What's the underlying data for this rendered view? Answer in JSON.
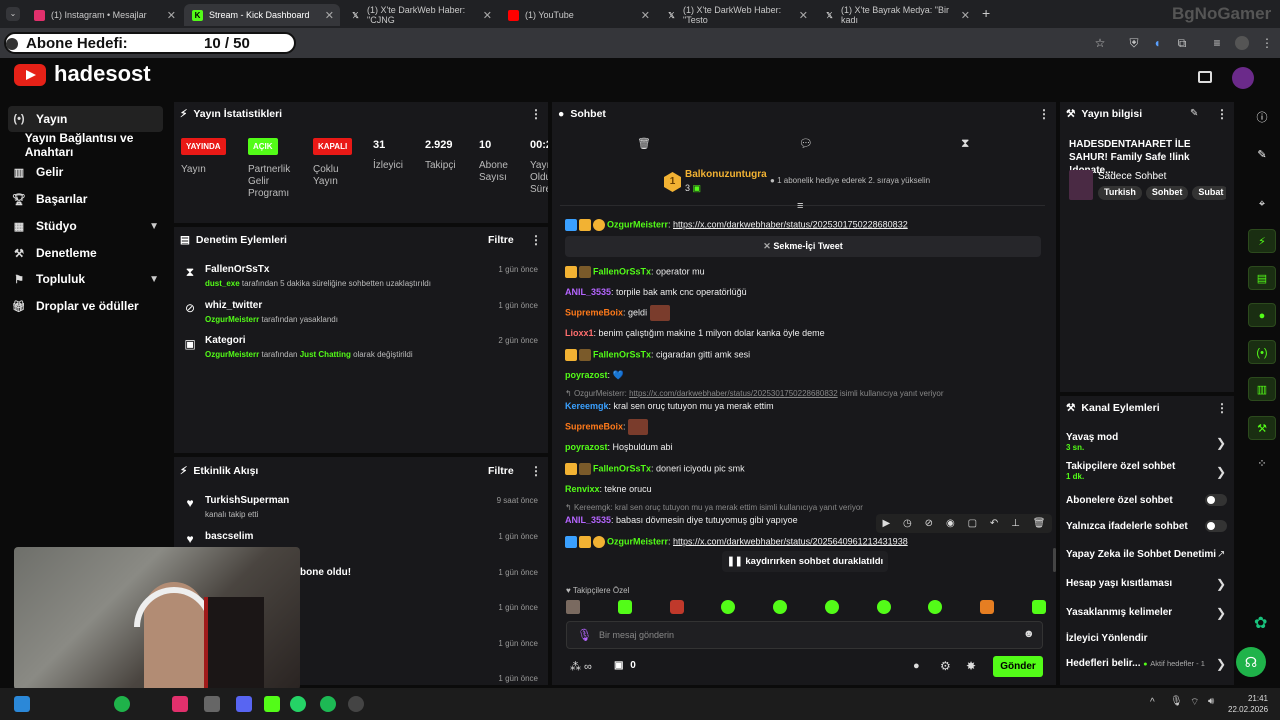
{
  "browser": {
    "tabs": [
      {
        "label": "(1) Instagram • Mesajlar",
        "color": "#e1306c"
      },
      {
        "label": "Stream - Kick Dashboard",
        "color": "#53fc18",
        "active": true
      },
      {
        "label": "(1) X'te DarkWeb Haber: \"CJNG",
        "color": "#000"
      },
      {
        "label": "(1) YouTube",
        "color": "#ff0000"
      },
      {
        "label": "(1) X'te DarkWeb Haber: \"Testo",
        "color": "#000"
      },
      {
        "label": "(1) X'te Bayrak Medya: \"Bir kadı",
        "color": "#000"
      }
    ],
    "watermark": "BgNoGamer"
  },
  "goal": {
    "label": "Abone Hedefi:",
    "value": "10 / 50"
  },
  "brand": "hadesost",
  "sidebar": [
    {
      "label": "Yayın",
      "icon": "broadcast-icon",
      "active": true
    },
    {
      "label": "Yayın Bağlantısı ve Anahtarı",
      "icon": ""
    },
    {
      "label": "Gelir",
      "icon": "revenue-icon"
    },
    {
      "label": "Başarılar",
      "icon": "trophy-icon"
    },
    {
      "label": "Stüdyo",
      "icon": "studio-icon",
      "chevron": true
    },
    {
      "label": "Denetleme",
      "icon": "wrench-icon"
    },
    {
      "label": "Topluluk",
      "icon": "community-icon",
      "chevron": true
    },
    {
      "label": "Droplar ve ödüller",
      "icon": "gift-icon"
    }
  ],
  "stats": {
    "title": "Yayın İstatistikleri",
    "badges": [
      {
        "text": "YAYINDA",
        "label": "Yayın",
        "bg": "#e91916",
        "fg": "#fff"
      },
      {
        "text": "AÇIK",
        "label": "Partnerlik Gelir Programı",
        "bg": "#53fc18",
        "fg": "#fff"
      },
      {
        "text": "KAPALI",
        "label": "Çoklu Yayın",
        "bg": "#e91916",
        "fg": "#fff"
      }
    ],
    "numbers": [
      {
        "value": "31",
        "label": "İzleyici"
      },
      {
        "value": "2.929",
        "label": "Takipçi"
      },
      {
        "value": "10",
        "label": "Abone Sayısı"
      },
      {
        "value": "00:2",
        "label": "Yayı Oldu Süre"
      }
    ]
  },
  "mod": {
    "title": "Denetim Eylemleri",
    "filter": "Filtre",
    "items": [
      {
        "name": "FallenOrSsTx",
        "who": "dust_exe",
        "text": "tarafından 5 dakika süreliğine sohbetten uzaklaştırıldı",
        "time": "1 gün önce"
      },
      {
        "name": "whiz_twitter",
        "who": "OzgurMeisterr",
        "text": "tarafından yasaklandı",
        "time": "1 gün önce"
      },
      {
        "name": "Kategori",
        "who": "OzgurMeisterr",
        "text": "tarafından",
        "extra": "Just Chatting",
        "text2": "olarak değiştirildi",
        "time": "2 gün önce"
      }
    ]
  },
  "activity": {
    "title": "Etkinlik Akışı",
    "filter": "Filtre",
    "items": [
      {
        "name": "TurkishSuperman",
        "sub": "kanalı takip etti",
        "time": "9 saat önce"
      },
      {
        "name": "bascselim",
        "sub": "",
        "time": "1 gün önce"
      },
      {
        "name": "",
        "sub": "",
        "partial": "bone oldu!",
        "time": "1 gün önce"
      },
      {
        "name": "",
        "sub": "",
        "time": "1 gün önce"
      },
      {
        "name": "",
        "sub": "",
        "time": "1 gün önce"
      },
      {
        "name": "",
        "sub": "",
        "time": "1 gün önce"
      }
    ]
  },
  "chat": {
    "title": "Sohbet",
    "pinned": {
      "user": "Balkonuzuntugra",
      "count": "3",
      "rank": "1",
      "text": "1 abonelik hediye ederek 2. sıraya yükselin"
    },
    "tweet_link": "https://x.com/darkwebhaber/status/2025301750228680832",
    "tweet_btn": "Sekme-İçi Tweet",
    "messages": [
      {
        "user": "OzgurMeisterr",
        "color": "#53fc18",
        "link": "https://x.com/darkwebhaber/status/2025301750228680832"
      },
      {
        "user": "FallenOrSsTx",
        "color": "#53fc18",
        "text": "operator mu"
      },
      {
        "user": "ANIL_3535",
        "color": "#b565ff",
        "text": "torpile bak amk cnc operatörlüğü"
      },
      {
        "user": "SupremeBoix",
        "color": "#ff7a1a",
        "text": "geldi"
      },
      {
        "user": "Lioxx1",
        "color": "#ff6e6e",
        "text": "benim çalıştığım makine 1 milyon dolar kanka öyle deme"
      },
      {
        "user": "FallenOrSsTx",
        "color": "#53fc18",
        "text": "cigaradan gitti amk sesi"
      },
      {
        "user": "poyrazost",
        "color": "#53fc18",
        "text": "💙"
      },
      {
        "user": "Kereemgk",
        "color": "#3aa0ff",
        "text": "kral sen oruç tutuyon mu ya merak ettim"
      },
      {
        "user": "SupremeBoix",
        "color": "#ff7a1a",
        "text": ""
      },
      {
        "user": "poyrazost",
        "color": "#53fc18",
        "text": "Hoşbuldum abi"
      },
      {
        "user": "FallenOrSsTx",
        "color": "#53fc18",
        "text": "doneri iciyodu pic smk"
      },
      {
        "user": "Renvixx",
        "color": "#53fc18",
        "text": "tekne orucu"
      },
      {
        "user": "ANIL_3535",
        "color": "#b565ff",
        "text": "babası dövmesin diye tutuyomuş gibi yapıyoe"
      },
      {
        "user": "OzgurMeisterr",
        "color": "#53fc18",
        "link": "https://x.com/darkwebhaber/status/2025640961213431938"
      }
    ],
    "reply1": {
      "user": "OzgurMeisterr:",
      "link": "https://x.com/darkwebhaber/status/2025301750228680832",
      "text": "isimli kullanıcıya yanıt veriyor"
    },
    "reply2": "Kereemgk: kral sen oruç tutuyon mu ya merak ettim isimli kullanıcıya yanıt veriyor",
    "paused": "kaydırırken sohbet duraklatıldı",
    "emote_label": "Takipçilere Özel",
    "placeholder": "Bir mesaj gönderin",
    "count": "0",
    "send": "Gönder"
  },
  "info": {
    "title": "Yayın bilgisi",
    "stream_title": "HADESDENTAHARET İLE SAHUR! Family Safe !link !donate...",
    "mode": "Sadece Sohbet",
    "tags": [
      "Turkish",
      "Sohbet",
      "Subat"
    ]
  },
  "actions": {
    "title": "Kanal Eylemleri",
    "items": [
      {
        "label": "Yavaş mod",
        "sub": "3 sn.",
        "type": "chevron"
      },
      {
        "label": "Takipçilere özel sohbet",
        "sub": "1 dk.",
        "type": "chevron"
      },
      {
        "label": "Abonelere özel sohbet",
        "type": "toggle"
      },
      {
        "label": "Yalnızca ifadelerle sohbet",
        "type": "toggle"
      },
      {
        "label": "Yapay Zeka ile Sohbet Denetimi",
        "type": "ext"
      },
      {
        "label": "Hesap yaşı kısıtlaması",
        "type": "chevron"
      },
      {
        "label": "Yasaklanmış kelimeler",
        "type": "chevron"
      },
      {
        "label": "İzleyici Yönlendir",
        "type": "none"
      },
      {
        "label": "Hedefleri belir...",
        "sub2": "Aktif hedefler - 1",
        "type": "chevron"
      }
    ]
  },
  "clock": {
    "time": "21:41",
    "date": "22.02.2026"
  }
}
